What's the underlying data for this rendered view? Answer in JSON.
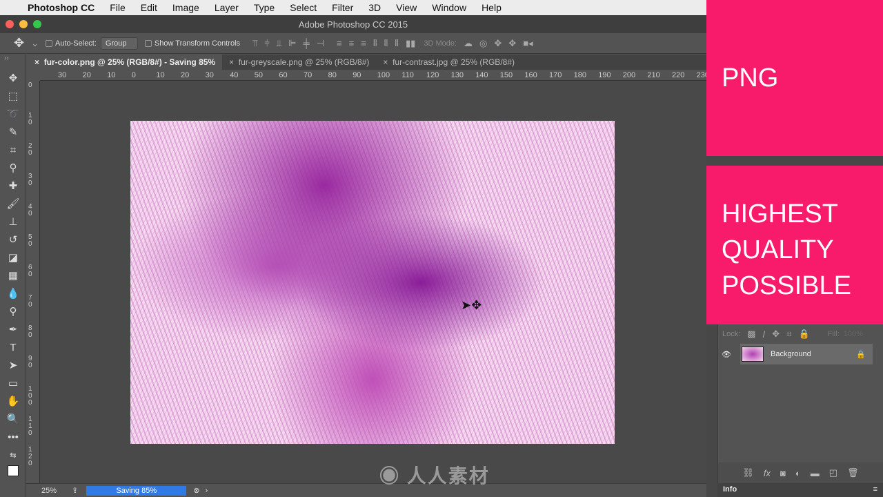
{
  "menubar": {
    "app": "Photoshop CC",
    "items": [
      "File",
      "Edit",
      "Image",
      "Layer",
      "Type",
      "Select",
      "Filter",
      "3D",
      "View",
      "Window",
      "Help"
    ]
  },
  "window": {
    "title": "Adobe Photoshop CC 2015"
  },
  "options": {
    "auto_select": "Auto-Select:",
    "group": "Group",
    "show_transform": "Show Transform Controls",
    "mode_3d": "3D Mode:"
  },
  "tabs": [
    {
      "label": "fur-color.png @ 25% (RGB/8#) - Saving 85%"
    },
    {
      "label": "fur-greyscale.png @ 25% (RGB/8#)"
    },
    {
      "label": "fur-contrast.jpg @ 25% (RGB/8#)"
    }
  ],
  "ruler_top": [
    "30",
    "20",
    "10",
    "0",
    "10",
    "20",
    "30",
    "40",
    "50",
    "60",
    "70",
    "80",
    "90",
    "100",
    "110",
    "120",
    "130",
    "140",
    "150",
    "160",
    "170",
    "180",
    "190",
    "200",
    "210",
    "220",
    "230"
  ],
  "ruler_left": [
    "0",
    "10",
    "20",
    "30",
    "40",
    "50",
    "60",
    "70",
    "80",
    "90",
    "100",
    "110",
    "120"
  ],
  "status": {
    "zoom": "25%",
    "progress_label": "Saving 85%",
    "progress": 0.85
  },
  "overlay": {
    "title1": "PNG",
    "title2": [
      "HIGHEST",
      "QUALITY",
      "POSSIBLE"
    ],
    "color": "#f81a6b"
  },
  "layers": {
    "lock_label": "Lock:",
    "fill_label": "Fill:",
    "fill_value": "100%",
    "layer_name": "Background"
  },
  "info_tab": "Info",
  "watermark": "人人素材"
}
